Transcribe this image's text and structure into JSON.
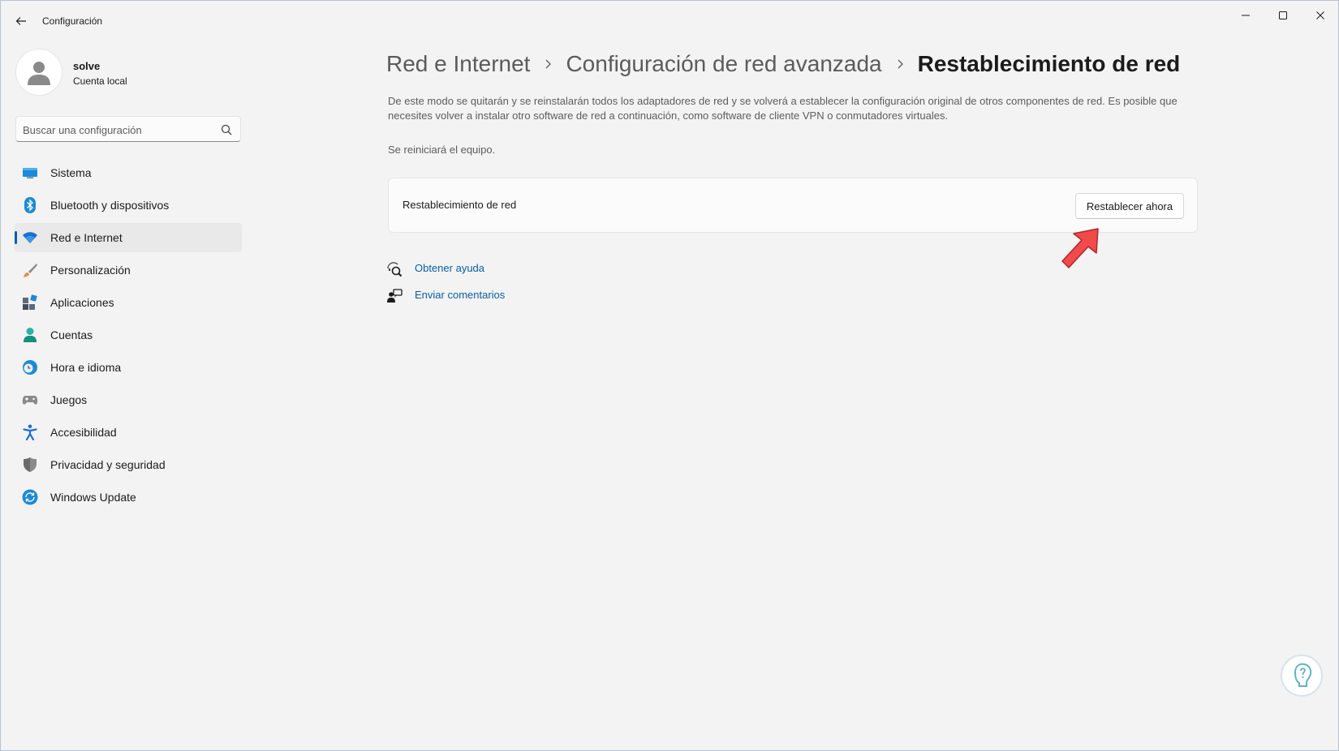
{
  "window": {
    "title": "Configuración"
  },
  "profile": {
    "name": "solve",
    "account_type": "Cuenta local"
  },
  "search": {
    "placeholder": "Buscar una configuración"
  },
  "sidebar": {
    "items": [
      {
        "label": "Sistema",
        "icon": "monitor-icon"
      },
      {
        "label": "Bluetooth y dispositivos",
        "icon": "bluetooth-icon"
      },
      {
        "label": "Red e Internet",
        "icon": "wifi-icon",
        "active": true
      },
      {
        "label": "Personalización",
        "icon": "brush-icon"
      },
      {
        "label": "Aplicaciones",
        "icon": "apps-icon"
      },
      {
        "label": "Cuentas",
        "icon": "person-icon"
      },
      {
        "label": "Hora e idioma",
        "icon": "globe-clock-icon"
      },
      {
        "label": "Juegos",
        "icon": "gamepad-icon"
      },
      {
        "label": "Accesibilidad",
        "icon": "accessibility-icon"
      },
      {
        "label": "Privacidad y seguridad",
        "icon": "shield-icon"
      },
      {
        "label": "Windows Update",
        "icon": "update-icon"
      }
    ]
  },
  "breadcrumb": {
    "items": [
      "Red e Internet",
      "Configuración de red avanzada"
    ],
    "current": "Restablecimiento de red"
  },
  "main": {
    "description": "De este modo se quitarán y se reinstalarán todos los adaptadores de red y se volverá a establecer la configuración original de otros componentes de red. Es posible que necesites volver a instalar otro software de red a continuación, como software de cliente VPN o conmutadores virtuales.",
    "restart_note": "Se reiniciará el equipo.",
    "card": {
      "label": "Restablecimiento de red",
      "button_label": "Restablecer ahora"
    },
    "links": [
      {
        "label": "Obtener ayuda",
        "icon": "help-icon"
      },
      {
        "label": "Enviar comentarios",
        "icon": "feedback-icon"
      }
    ]
  },
  "colors": {
    "accent": "#005fb8",
    "link": "#0a5ea8",
    "annotation_arrow": "#f04a4a"
  }
}
